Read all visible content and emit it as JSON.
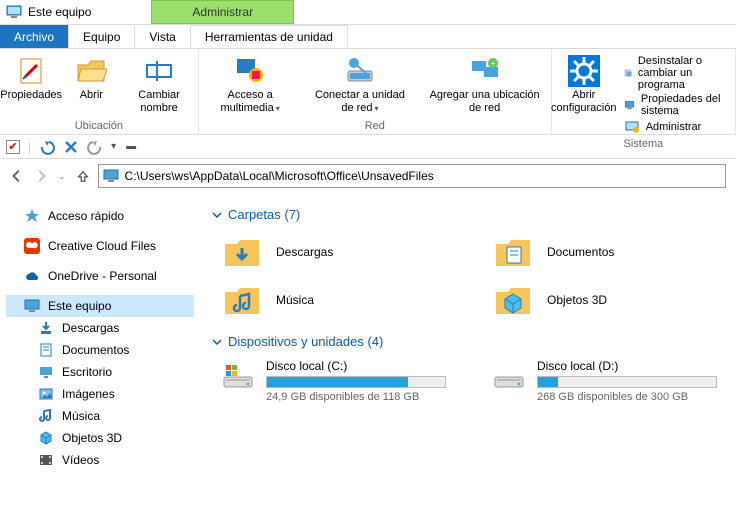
{
  "titlebar": {
    "title": "Este equipo",
    "context_tab": "Administrar"
  },
  "tabs": {
    "archivo": "Archivo",
    "equipo": "Equipo",
    "vista": "Vista",
    "herramientas": "Herramientas de unidad"
  },
  "ribbon": {
    "ubicacion": {
      "label": "Ubicación",
      "propiedades": "Propiedades",
      "abrir": "Abrir",
      "cambiar_nombre": "Cambiar nombre"
    },
    "red": {
      "label": "Red",
      "acceso_multimedia": "Acceso a multimedia",
      "conectar_unidad": "Conectar a unidad de red",
      "agregar_ubicacion": "Agregar una ubicación de red"
    },
    "sistema": {
      "label": "Sistema",
      "abrir_config": "Abrir configuración",
      "desinstalar": "Desinstalar o cambiar un programa",
      "propiedades_sistema": "Propiedades del sistema",
      "administrar": "Administrar"
    }
  },
  "address": {
    "path": "C:\\Users\\ws\\AppData\\Local\\Microsoft\\Office\\UnsavedFiles"
  },
  "sidebar": {
    "acceso_rapido": "Acceso rápido",
    "creative_cloud": "Creative Cloud Files",
    "onedrive": "OneDrive - Personal",
    "este_equipo": "Este equipo",
    "descargas": "Descargas",
    "documentos": "Documentos",
    "escritorio": "Escritorio",
    "imagenes": "Imágenes",
    "musica": "Música",
    "objetos3d": "Objetos 3D",
    "videos": "Vídeos"
  },
  "sections": {
    "carpetas": "Carpetas (7)",
    "dispositivos": "Dispositivos y unidades (4)"
  },
  "folders": {
    "descargas": "Descargas",
    "documentos": "Documentos",
    "musica": "Música",
    "objetos3d": "Objetos 3D"
  },
  "drives": {
    "c": {
      "name": "Disco local (C:)",
      "free": "24,9 GB disponibles de 118 GB",
      "fill_pct": 79
    },
    "d": {
      "name": "Disco local (D:)",
      "free": "268 GB disponibles de 300 GB",
      "fill_pct": 11
    }
  }
}
